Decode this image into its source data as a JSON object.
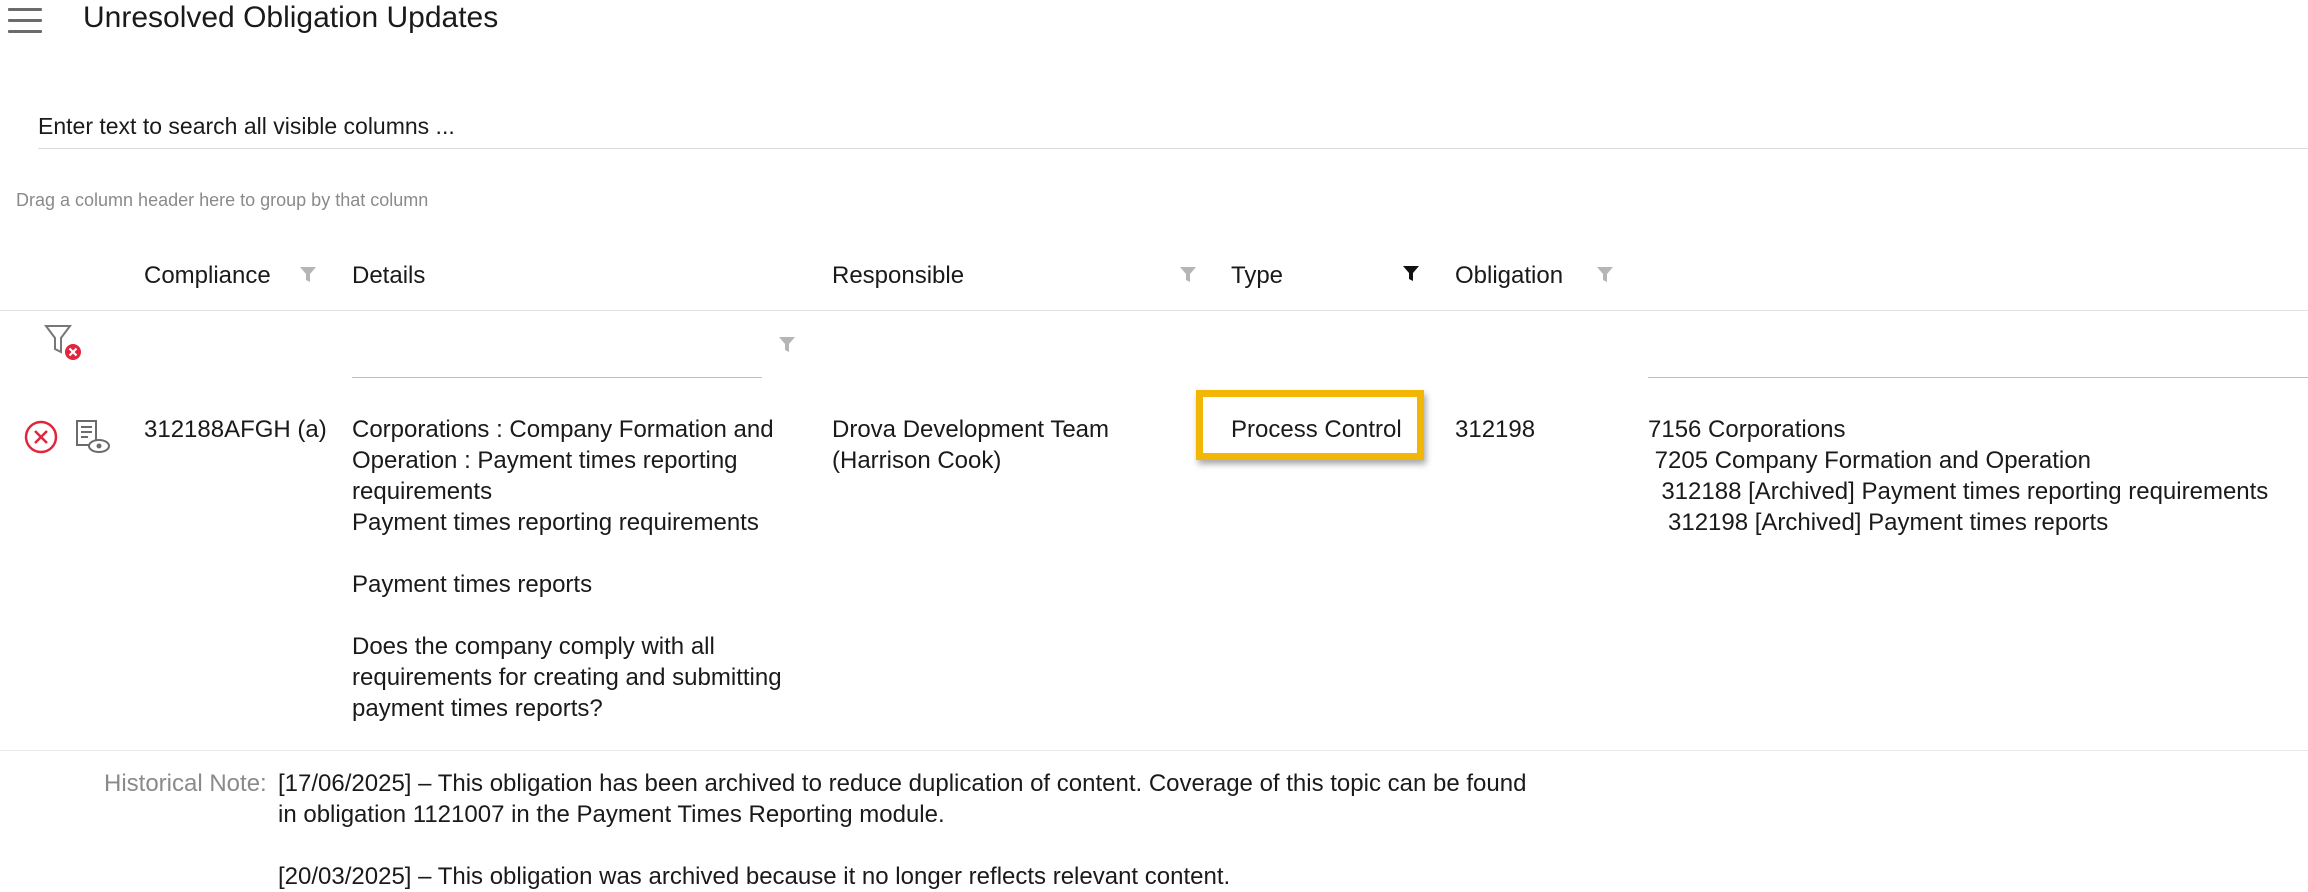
{
  "header": {
    "title": "Unresolved Obligation Updates"
  },
  "search": {
    "placeholder": "Enter text to search all visible columns ..."
  },
  "grid": {
    "group_hint": "Drag a column header here to group by that column",
    "columns": {
      "compliance": "Compliance",
      "details": "Details",
      "responsible": "Responsible",
      "type": "Type",
      "obligation": "Obligation"
    },
    "row": {
      "compliance": "312188AFGH (a)",
      "details": [
        "Corporations : Company Formation and",
        "Operation : Payment times reporting",
        "requirements",
        "Payment times reporting requirements",
        "",
        "Payment times reports",
        "",
        "Does the company comply with all",
        "requirements for creating and submitting",
        "payment times reports?"
      ],
      "responsible": [
        "Drova Development Team",
        "(Harrison Cook)"
      ],
      "type": "Process Control",
      "obligation": "312198",
      "hierarchy": [
        "7156 Corporations",
        " 7205 Company Formation and Operation",
        "  312188 [Archived] Payment times reporting requirements",
        "   312198 [Archived] Payment times reports"
      ]
    },
    "historical_note": {
      "label": "Historical Note:",
      "lines": [
        "[17/06/2025] – This obligation has been archived to reduce duplication of content. Coverage of this topic can be found",
        "in obligation 1121007 in the Payment Times Reporting module.",
        "",
        "[20/03/2025] – This obligation was archived because it no longer reflects relevant content."
      ]
    }
  },
  "colors": {
    "highlight": "#f2b705",
    "danger": "#e0263c",
    "filter_active": "#111111",
    "filter_inactive": "#b5b5b5"
  }
}
